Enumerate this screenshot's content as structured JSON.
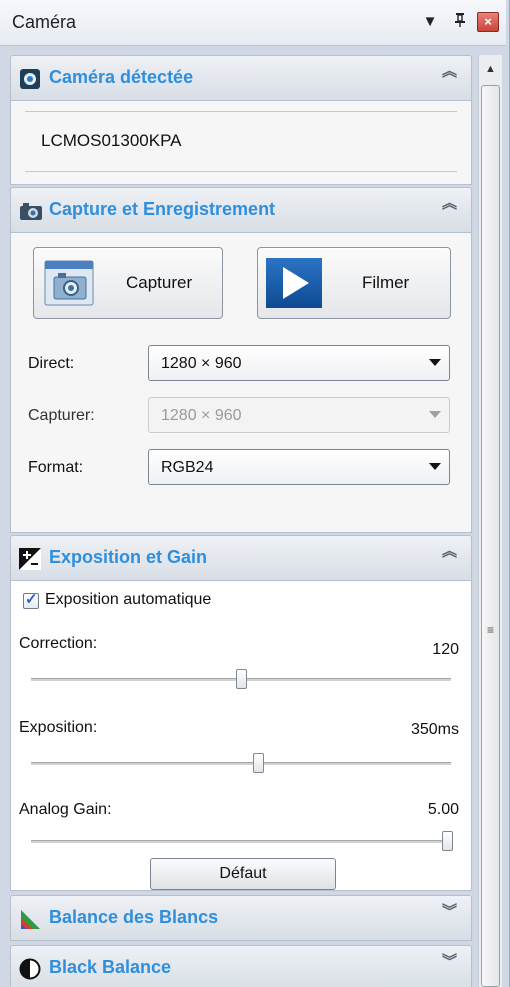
{
  "window": {
    "title": "Caméra"
  },
  "sections": {
    "camera": {
      "title": "Caméra détectée",
      "device": "LCMOS01300KPA"
    },
    "capture": {
      "title": "Capture et Enregistrement",
      "capture_button": "Capturer",
      "record_button": "Filmer",
      "direct_label": "Direct:",
      "direct_value": "1280 × 960",
      "capture_label": "Capturer:",
      "capture_value": "1280 × 960",
      "format_label": "Format:",
      "format_value": "RGB24"
    },
    "exposure": {
      "title": "Exposition et Gain",
      "auto_exposure_label": "Exposition automatique",
      "auto_exposure_checked": true,
      "correction_label": "Correction:",
      "correction_value": "120",
      "correction_level": 0.5,
      "exposure_label": "Exposition:",
      "exposure_value": "350ms",
      "exposure_level": 0.54,
      "gain_label": "Analog Gain:",
      "gain_value": "5.00",
      "gain_level": 0.99,
      "default_button": "Défaut"
    },
    "white_balance": {
      "title": "Balance des Blancs"
    },
    "black_balance": {
      "title": "Black Balance"
    }
  },
  "colors": {
    "section_title": "#2f8fdd",
    "close_button": "#c9433a"
  },
  "icons": {
    "camera_section": "webcam-icon",
    "capture_section": "camera-icon",
    "exposure_section": "exposure-icon",
    "white_balance_section": "color-spectrum-icon",
    "black_balance_section": "contrast-icon"
  }
}
